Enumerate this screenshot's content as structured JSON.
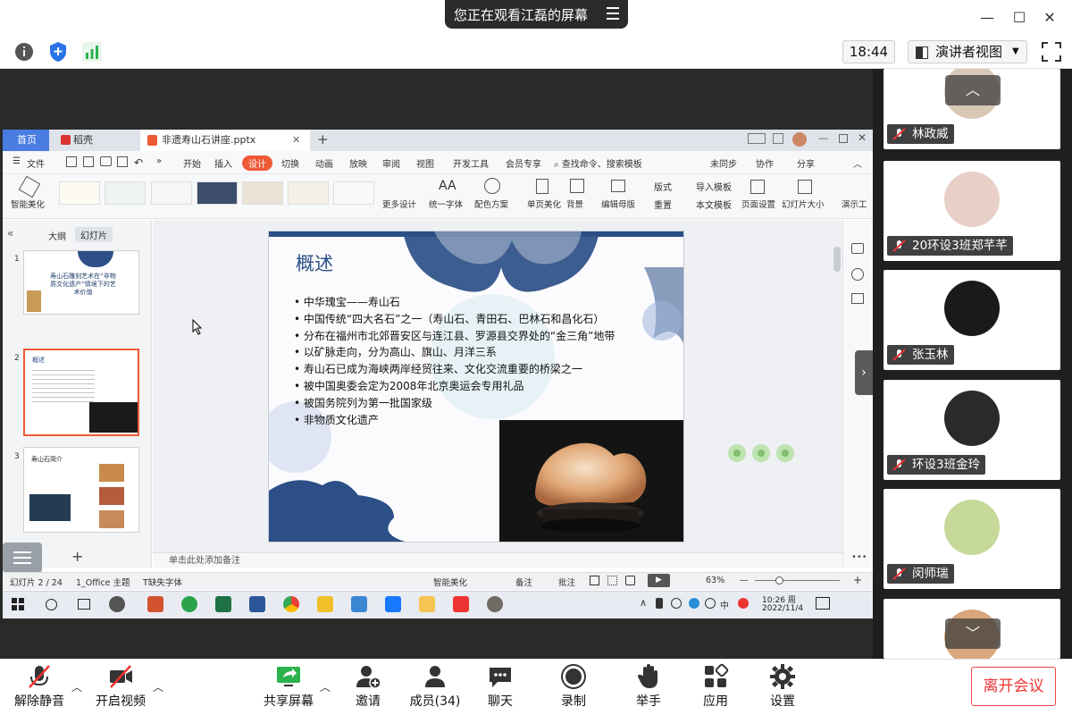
{
  "window": {
    "banner_text": "您正在观看江磊的屏幕",
    "minimize": "—",
    "maximize": "☐",
    "close": "✕"
  },
  "meeting_bar": {
    "clock": "18:44",
    "view_mode": "演讲者视图"
  },
  "wps": {
    "tabs": [
      "首页",
      "稻壳",
      "非遗寿山石讲座.pptx"
    ],
    "menu": [
      "开始",
      "插入",
      "设计",
      "切换",
      "动画",
      "放映",
      "审阅",
      "视图",
      "开发工具",
      "会员专享"
    ],
    "active_menu": "设计",
    "search_placeholder": "查找命令、搜索模板",
    "menu_right": [
      "未同步",
      "协作",
      "分享"
    ],
    "file_label": "文件",
    "ribbon_items": [
      "智能美化",
      "更多设计",
      "统一字体",
      "配色方案",
      "单页美化",
      "背景",
      "编辑母版",
      "版式",
      "重置",
      "导入模板",
      "本文模板",
      "页面设置",
      "幻灯片大小",
      "演示工"
    ],
    "left_tabs": [
      "大纲",
      "幻灯片"
    ],
    "slide_numbers": [
      "1",
      "2",
      "3"
    ],
    "thumb1_title": "寿山石雕刻艺术在“非物质文化遗产”情境下的艺术价值",
    "thumb2_title": "概述",
    "thumb3_title": "寿山石简介",
    "notes_placeholder": "单击此处添加备注",
    "status": {
      "slide_count": "幻灯片 2 / 24",
      "theme": "1_Office 主题",
      "missing_font": "缺失字体",
      "smart": "智能美化",
      "notes": "备注",
      "comments": "批注",
      "zoom": "63%"
    },
    "taskbar": {
      "time": "10:26 周",
      "date": "2022/11/4",
      "ime": "中"
    }
  },
  "slide": {
    "title": "概述",
    "bullets": [
      "中华瑰宝——寿山石",
      "中国传统“四大名石”之一（寿山石、青田石、巴林石和昌化石）",
      "分布在福州市北郊晋安区与连江县、罗源县交界处的“金三角”地带",
      "以矿脉走向，分为高山、旗山、月洋三系",
      "寿山石已成为海峡两岸经贸往来、文化交流重要的桥梁之一",
      "被中国奥委会定为2008年北京奥运会专用礼品",
      "被国务院列为第一批国家级",
      " 非物质文化遗产"
    ]
  },
  "participants": [
    {
      "name": "林政威",
      "avatar_color": "#d9c7b5"
    },
    {
      "name": "20环设3班郑芊芊",
      "avatar_color": "#e8d0c8"
    },
    {
      "name": "张玉林",
      "avatar_color": "#1a1a1a"
    },
    {
      "name": "环设3班金玲",
      "avatar_color": "#2a2a2a"
    },
    {
      "name": "闵师瑞",
      "avatar_color": "#c7d99a"
    },
    {
      "name": "",
      "avatar_color": "#d8a77c"
    }
  ],
  "scroll": {
    "up": "︿",
    "down": "﹀"
  },
  "bottom": {
    "unmute": "解除静音",
    "video": "开启视频",
    "share": "共享屏幕",
    "invite": "邀请",
    "members": "成员(34)",
    "chat": "聊天",
    "record": "录制",
    "raise_hand": "举手",
    "apps": "应用",
    "settings": "设置",
    "leave": "离开会议"
  },
  "colors": {
    "accent_red": "#e03a3a",
    "wps_active": "#ee5a36",
    "slide_title": "#2a4f85",
    "share_green": "#2bb24c"
  }
}
